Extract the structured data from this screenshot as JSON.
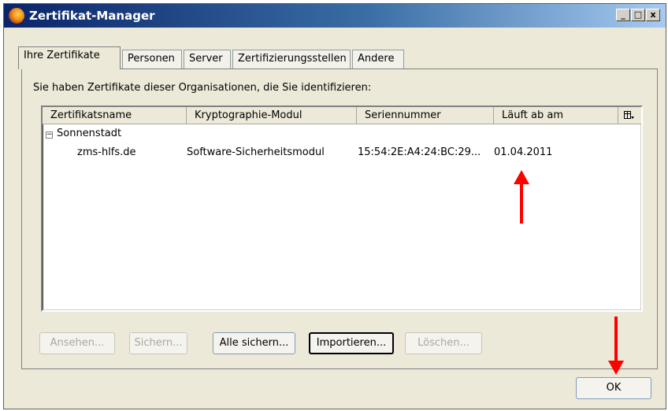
{
  "window": {
    "title": "Zertifikat-Manager",
    "controls": [
      "_",
      "□",
      "x"
    ]
  },
  "tabs": [
    {
      "label": "Ihre Zertifikate",
      "active": true
    },
    {
      "label": "Personen"
    },
    {
      "label": "Server"
    },
    {
      "label": "Zertifizierungsstellen"
    },
    {
      "label": "Andere"
    }
  ],
  "panel": {
    "description": "Sie haben Zertifikate dieser Organisationen, die Sie identifizieren:",
    "columns": [
      "Zertifikatsname",
      "Kryptographie-Modul",
      "Seriennummer",
      "Läuft ab am"
    ],
    "column_picker_icon": "column-picker-icon",
    "group": {
      "label": "Sonnenstadt",
      "expander": "−"
    },
    "rows": [
      {
        "name": "zms-hlfs.de",
        "module": "Software-Sicherheitsmodul",
        "serial": "15:54:2E:A4:24:BC:29...",
        "expires": "01.04.2011"
      }
    ],
    "buttons": {
      "view": "Ansehen...",
      "backup": "Sichern...",
      "backup_all": "Alle sichern...",
      "import": "Importieren...",
      "delete": "Löschen..."
    }
  },
  "ok_label": "OK",
  "annotation_color": "#ff0000"
}
